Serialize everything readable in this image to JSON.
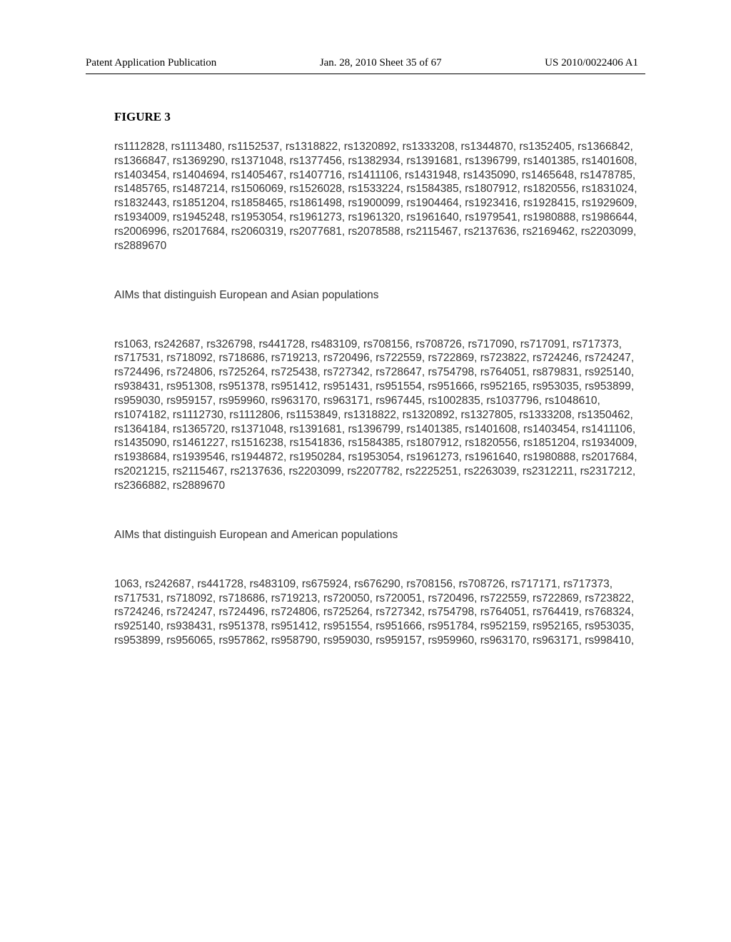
{
  "header": {
    "left": "Patent Application Publication",
    "center": "Jan. 28, 2010  Sheet 35 of 67",
    "right": "US 2010/0022406 A1"
  },
  "figure_label": "FIGURE 3",
  "block1": "rs1112828, rs1113480, rs1152537, rs1318822, rs1320892, rs1333208, rs1344870, rs1352405, rs1366842, rs1366847, rs1369290, rs1371048, rs1377456, rs1382934, rs1391681, rs1396799, rs1401385, rs1401608, rs1403454, rs1404694, rs1405467, rs1407716, rs1411106, rs1431948, rs1435090, rs1465648, rs1478785, rs1485765, rs1487214, rs1506069, rs1526028, rs1533224, rs1584385, rs1807912, rs1820556, rs1831024, rs1832443, rs1851204, rs1858465, rs1861498, rs1900099, rs1904464, rs1923416, rs1928415, rs1929609, rs1934009, rs1945248, rs1953054, rs1961273, rs1961320, rs1961640, rs1979541, rs1980888, rs1986644, rs2006996, rs2017684, rs2060319, rs2077681, rs2078588, rs2115467, rs2137636, rs2169462, rs2203099, rs2889670",
  "section2_title": "AIMs that distinguish European and Asian populations",
  "block2": "rs1063, rs242687, rs326798, rs441728, rs483109, rs708156, rs708726, rs717090, rs717091, rs717373, rs717531, rs718092, rs718686, rs719213, rs720496, rs722559, rs722869, rs723822, rs724246, rs724247, rs724496, rs724806, rs725264, rs725438, rs727342, rs728647, rs754798, rs764051, rs879831, rs925140, rs938431, rs951308, rs951378, rs951412, rs951431, rs951554, rs951666, rs952165, rs953035, rs953899, rs959030, rs959157, rs959960, rs963170, rs963171, rs967445, rs1002835, rs1037796, rs1048610, rs1074182, rs1112730, rs1112806, rs1153849, rs1318822, rs1320892, rs1327805, rs1333208, rs1350462, rs1364184, rs1365720, rs1371048, rs1391681, rs1396799, rs1401385, rs1401608, rs1403454, rs1411106, rs1435090, rs1461227, rs1516238, rs1541836, rs1584385, rs1807912, rs1820556, rs1851204, rs1934009, rs1938684, rs1939546, rs1944872, rs1950284, rs1953054, rs1961273, rs1961640, rs1980888, rs2017684, rs2021215, rs2115467, rs2137636, rs2203099, rs2207782, rs2225251, rs2263039, rs2312211, rs2317212, rs2366882, rs2889670",
  "section3_title": "AIMs that distinguish European and American populations",
  "block3": "1063, rs242687, rs441728, rs483109, rs675924, rs676290, rs708156, rs708726, rs717171, rs717373, rs717531, rs718092, rs718686, rs719213, rs720050, rs720051, rs720496, rs722559, rs722869, rs723822, rs724246, rs724247, rs724496, rs724806, rs725264, rs727342, rs754798, rs764051, rs764419, rs768324, rs925140, rs938431, rs951378, rs951412, rs951554, rs951666, rs951784, rs952159, rs952165, rs953035, rs953899, rs956065, rs957862, rs958790, rs959030, rs959157, rs959960, rs963170, rs963171, rs998410,"
}
